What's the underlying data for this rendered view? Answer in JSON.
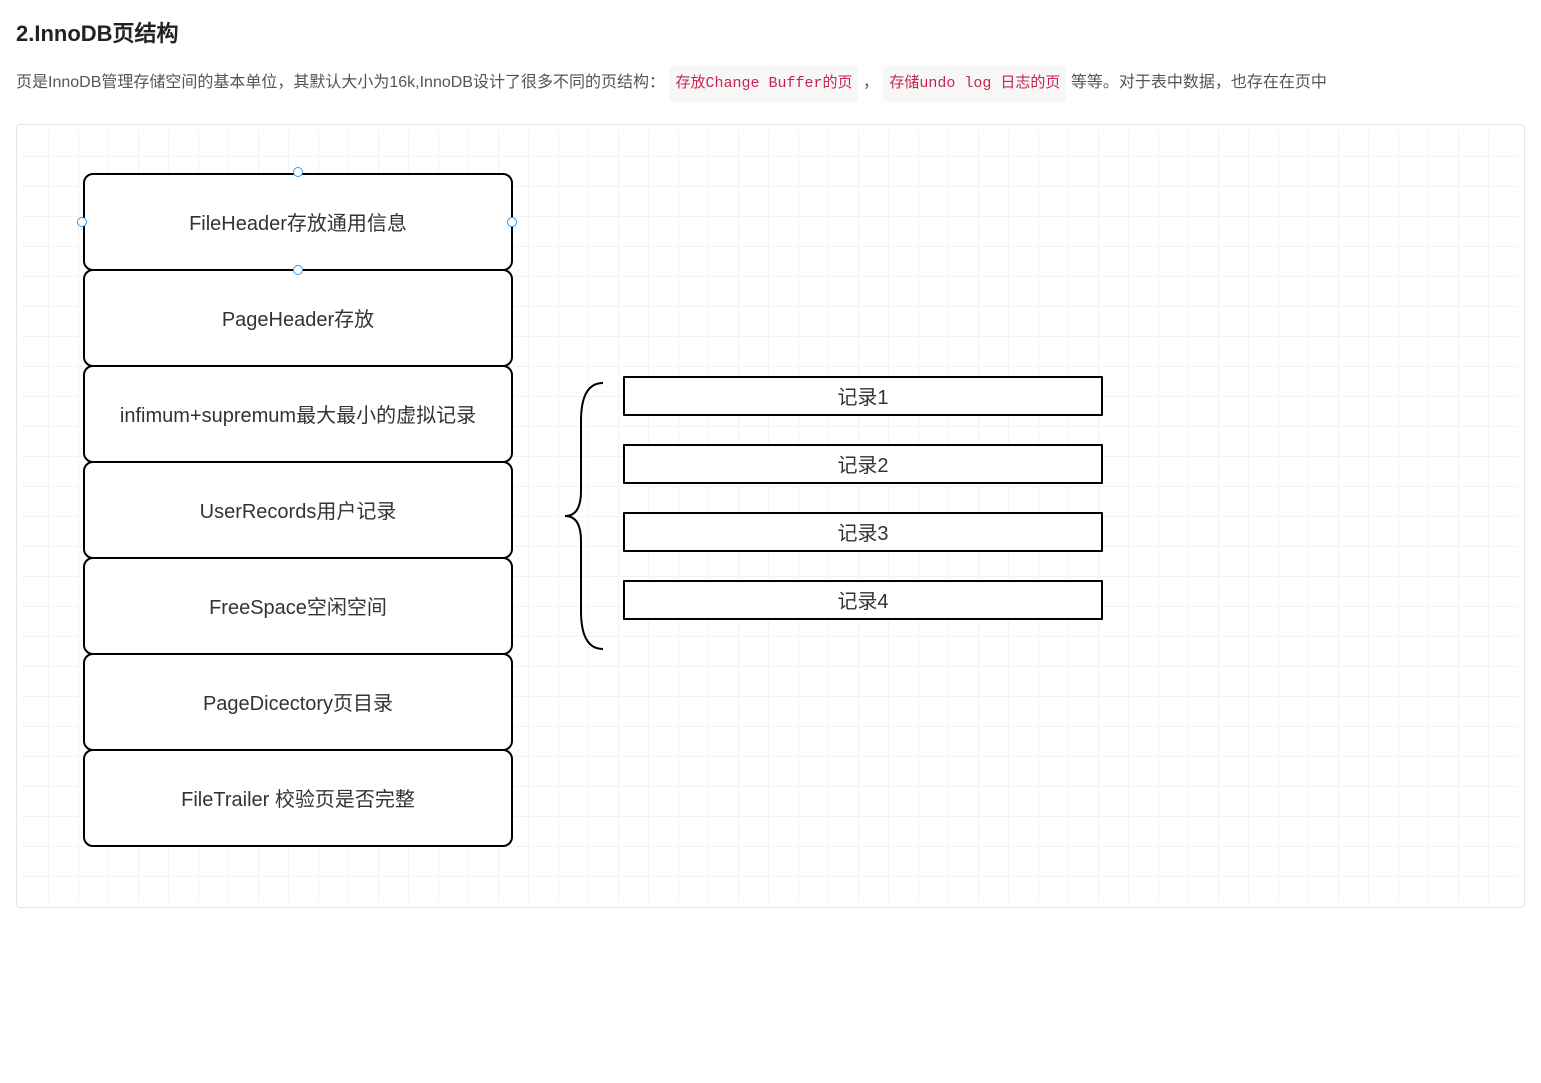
{
  "heading": "2.InnoDB页结构",
  "description": {
    "part1": "页是InnoDB管理存储空间的基本单位，其默认大小为16k,InnoDB设计了很多不同的页结构：",
    "chip1": "存放Change Buffer的页",
    "sep1": "，",
    "chip2": "存储undo log 日志的页",
    "part2": " 等等。对于表中数据，也存在在页中"
  },
  "page_structure": [
    "FileHeader存放通用信息",
    "PageHeader存放",
    "infimum+supremum最大最小的虚拟记录",
    "UserRecords用户记录",
    "FreeSpace空闲空间",
    "PageDicectory页目录",
    "FileTrailer 校验页是否完整"
  ],
  "records": [
    "记录1",
    "记录2",
    "记录3",
    "记录4"
  ],
  "colors": {
    "chip_text": "#c7254e",
    "chip_bg": "#f7f7f7",
    "border": "#000000",
    "handle": "#2a9df4"
  }
}
